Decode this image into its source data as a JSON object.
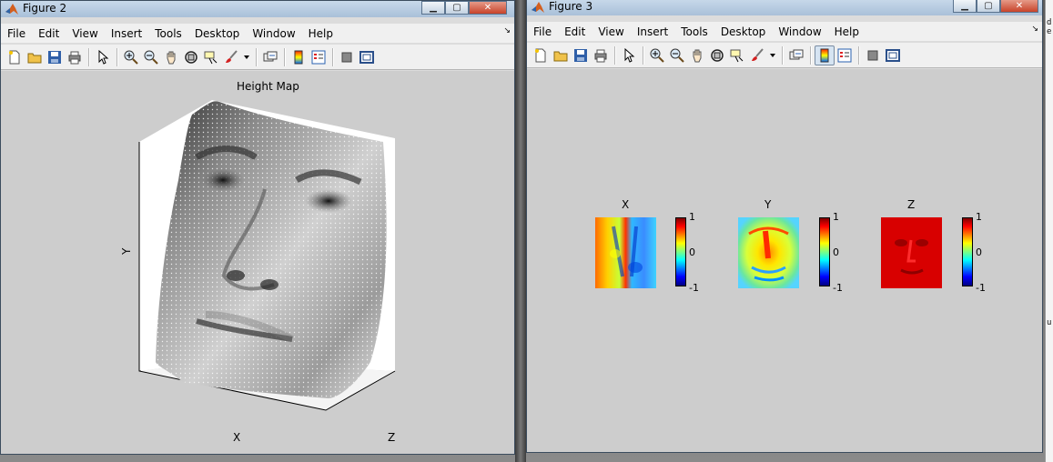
{
  "windows": [
    {
      "id": "figure2",
      "title": "Figure 2",
      "plot_title": "Height Map",
      "axis_labels": {
        "x": "X",
        "y": "Y",
        "z": "Z"
      }
    },
    {
      "id": "figure3",
      "title": "Figure 3",
      "subplots": [
        {
          "title": "X",
          "colorbar_ticks": [
            "1",
            "0",
            "-1"
          ]
        },
        {
          "title": "Y",
          "colorbar_ticks": [
            "1",
            "0",
            "-1"
          ]
        },
        {
          "title": "Z",
          "colorbar_ticks": [
            "1",
            "0",
            "-1"
          ]
        }
      ]
    }
  ],
  "menu": [
    "File",
    "Edit",
    "View",
    "Insert",
    "Tools",
    "Desktop",
    "Window",
    "Help"
  ],
  "menu_dock_glyph": "↘",
  "background_window_text": [
    "d",
    "e",
    "u"
  ],
  "toolbar_icons": [
    "new-figure-icon",
    "open-file-icon",
    "save-icon",
    "print-icon",
    "edit-plot-arrow-icon",
    "zoom-in-icon",
    "zoom-out-icon",
    "pan-hand-icon",
    "rotate-3d-icon",
    "data-cursor-icon",
    "brush-icon",
    "brush-dropdown-icon",
    "link-plot-icon",
    "insert-colorbar-icon",
    "insert-legend-icon",
    "hide-plot-tools-icon",
    "show-plot-tools-icon"
  ],
  "colors": {
    "titlebar": "#b6cadf",
    "canvas": "#cdcdcd",
    "close_button": "#c8432a"
  }
}
